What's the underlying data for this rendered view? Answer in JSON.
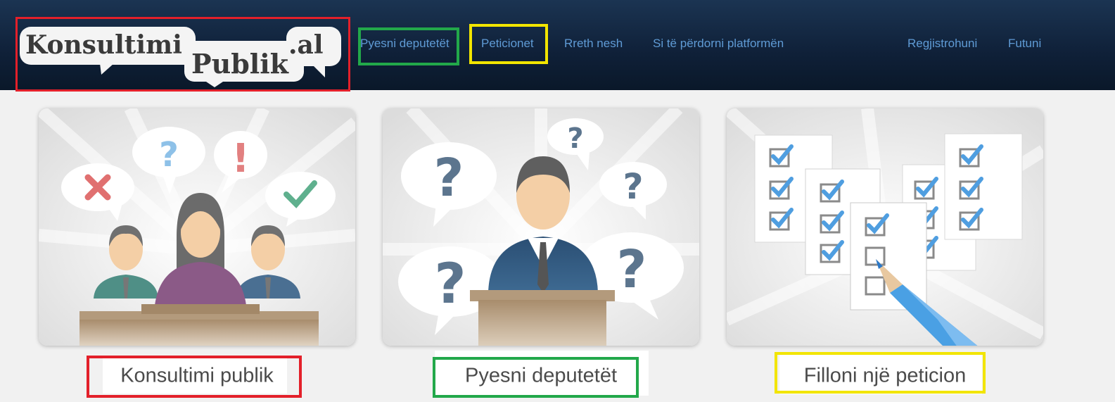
{
  "logo": {
    "word1": "Konsultimi",
    "word2": "Publik",
    "word3": ".al"
  },
  "nav": {
    "items": [
      {
        "label": "Pyesni deputetët"
      },
      {
        "label": "Peticionet"
      },
      {
        "label": "Rreth nesh"
      },
      {
        "label": "Si të përdorni platformën"
      }
    ],
    "register_label": "Regjistrohuni",
    "login_label": "Futuni"
  },
  "cards": [
    {
      "caption": "Konsultimi publik",
      "icon": "public-consultation-illustration"
    },
    {
      "caption": "Pyesni deputetët",
      "icon": "ask-deputies-illustration"
    },
    {
      "caption": "Filloni një peticion",
      "icon": "petition-checklist-illustration"
    }
  ],
  "colors": {
    "header_bg": "#0f2038",
    "nav_link": "#5f9bd5",
    "highlight_red": "#e3202a",
    "highlight_green": "#22a84a",
    "highlight_yellow": "#f2e500",
    "caption_text": "#4b4b4b"
  }
}
